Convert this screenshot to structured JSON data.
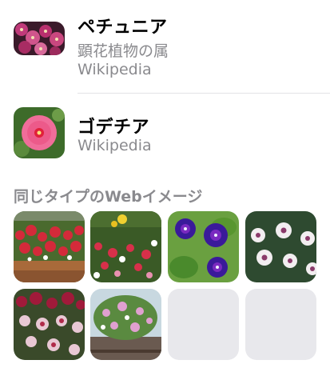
{
  "results": [
    {
      "title": "ペチュニア",
      "description": "顕花植物の属",
      "source": "Wikipedia",
      "thumb_icon": "petunia-photo"
    },
    {
      "title": "ゴデチア",
      "source": "Wikipedia",
      "thumb_icon": "godetia-photo"
    }
  ],
  "similar_images": {
    "heading": "同じタイプのWebイメージ",
    "tiles": [
      {
        "icon": "red-petunia-planter-photo"
      },
      {
        "icon": "petunia-garden-bed-photo"
      },
      {
        "icon": "purple-morning-glory-photo"
      },
      {
        "icon": "white-purple-flowers-photo"
      },
      {
        "icon": "pink-white-flowers-photo"
      },
      {
        "icon": "hanging-basket-photo"
      },
      {
        "icon": "loading-placeholder"
      },
      {
        "icon": "loading-placeholder"
      }
    ]
  },
  "colors": {
    "secondary_text": "#8a8a8e",
    "placeholder": "#e8e8ec"
  }
}
